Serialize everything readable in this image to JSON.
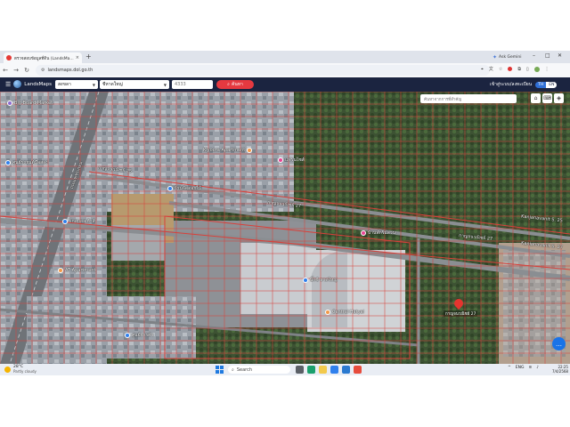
{
  "browser": {
    "tab_title": "ตรวจสอบข้อมูลที่ดิน (LandsMa...",
    "tab_close": "×",
    "new_tab": "+",
    "ask_gemini": "Ask Gemini",
    "url": "landsmaps.dol.go.th"
  },
  "header": {
    "app_name": "LandsMaps",
    "province": "สงขลา",
    "district": "ชีหาดใหญ่",
    "parcel_number": "4333",
    "search_label": "ค้นหา",
    "login_label": "เข้าสู่ระบบ/ลงทะเบียน",
    "lang_th": "TH",
    "lang_en": "EN"
  },
  "map": {
    "search_placeholder": "ค้นหาจากการที่สำคัญ",
    "road_labels": [
      "ถนนเพชรเกษม",
      "กาญจนวณิชย์ 25",
      "กาญจนวณิชย์ 27",
      "กาญจนวณิชย์ 27",
      "Kanjanavanit S. 25",
      "Kanjanavanit S. 27"
    ],
    "pois": [
      {
        "label": "Big Board Market",
        "color": "#8c6bd1"
      },
      {
        "label": "ศูนย์รถยนต์มือสอง",
        "color": "#2f80ed"
      },
      {
        "label": "Kiyoora Apartment",
        "color": "#f2994a"
      },
      {
        "label": "แฟรนไชส์",
        "color": "#e84393"
      },
      {
        "label": "ร้านจัดดอกไม้",
        "color": "#2f80ed"
      },
      {
        "label": "โกลบอลเฮ้าส์",
        "color": "#2f80ed"
      },
      {
        "label": "AT Apartment",
        "color": "#f2994a"
      },
      {
        "label": "บิ๊กซี หาดใหญ่",
        "color": "#2f80ed"
      },
      {
        "label": "Central Hatyai",
        "color": "#f2994a"
      },
      {
        "label": "บ้านพักริมสวน",
        "color": "#e84393"
      },
      {
        "label": "ศูนย์การค้า",
        "color": "#2f80ed"
      }
    ],
    "pin_label": "กาญจนวณิชย์ 27"
  },
  "taskbar": {
    "temperature": "28°C",
    "condition": "Partly cloudy",
    "search_label": "Search",
    "language": "ENG",
    "time": "22:25",
    "date": "7/4/2568"
  },
  "colors": {
    "header_bg": "#1b2440",
    "search_button": "#e53940",
    "parcel_line": "#d9403a",
    "fab": "#1a73e8"
  }
}
